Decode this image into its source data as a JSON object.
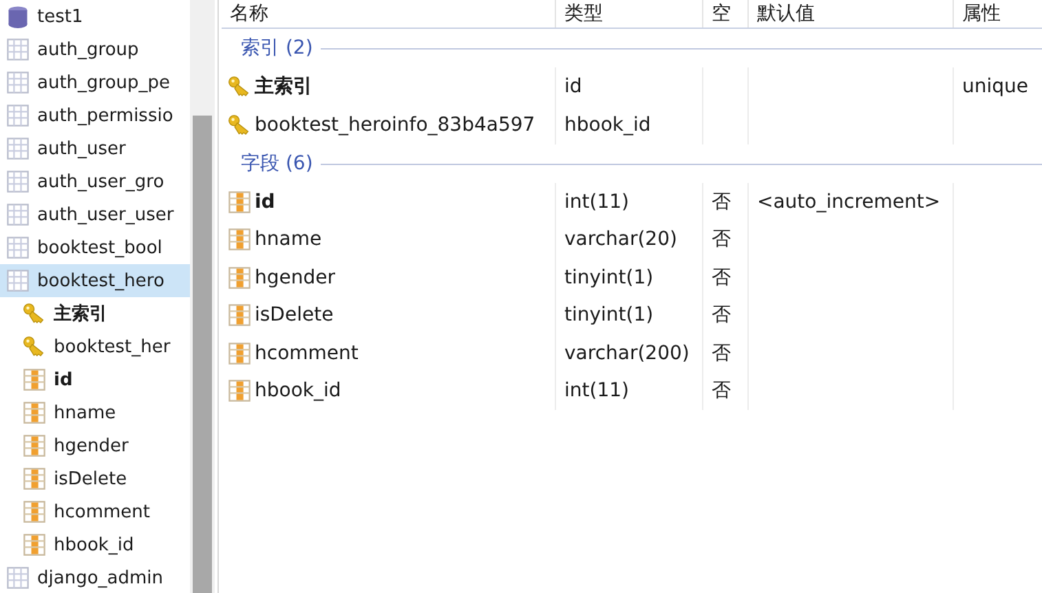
{
  "tree": [
    {
      "kind": "database",
      "label": "test1",
      "children": [
        {
          "kind": "table",
          "label": "auth_group",
          "selected": false
        },
        {
          "kind": "table",
          "label": "auth_group_pe",
          "selected": false
        },
        {
          "kind": "table",
          "label": "auth_permissio",
          "selected": false
        },
        {
          "kind": "table",
          "label": "auth_user",
          "selected": false
        },
        {
          "kind": "table",
          "label": "auth_user_gro",
          "selected": false
        },
        {
          "kind": "table",
          "label": "auth_user_user",
          "selected": false
        },
        {
          "kind": "table",
          "label": "booktest_bool",
          "selected": false
        },
        {
          "kind": "table",
          "label": "booktest_hero",
          "selected": true,
          "children": [
            {
              "kind": "index",
              "label": "主索引",
              "primary": true
            },
            {
              "kind": "index",
              "label": "booktest_her",
              "primary": false
            },
            {
              "kind": "field",
              "label": "id",
              "primary": true
            },
            {
              "kind": "field",
              "label": "hname",
              "primary": false
            },
            {
              "kind": "field",
              "label": "hgender",
              "primary": false
            },
            {
              "kind": "field",
              "label": "isDelete",
              "primary": false
            },
            {
              "kind": "field",
              "label": "hcomment",
              "primary": false
            },
            {
              "kind": "field",
              "label": "hbook_id",
              "primary": false
            }
          ]
        },
        {
          "kind": "table",
          "label": "django_admin",
          "selected": false
        }
      ]
    }
  ],
  "table": {
    "columns": [
      "名称",
      "类型",
      "空",
      "默认值",
      "属性"
    ],
    "sections": [
      {
        "title": "索引 (2)",
        "kind": "index",
        "rows": [
          {
            "name": "主索引",
            "primary": true,
            "type": "id",
            "attr": "unique"
          },
          {
            "name": "booktest_heroinfo_83b4a597",
            "primary": false,
            "type": "hbook_id"
          }
        ]
      },
      {
        "title": "字段 (6)",
        "kind": "field",
        "rows": [
          {
            "name": "id",
            "primary": true,
            "type": "int(11)",
            "null": "否",
            "default": "<auto_increment>"
          },
          {
            "name": "hname",
            "primary": false,
            "type": "varchar(20)",
            "null": "否"
          },
          {
            "name": "hgender",
            "primary": false,
            "type": "tinyint(1)",
            "null": "否"
          },
          {
            "name": "isDelete",
            "primary": false,
            "type": "tinyint(1)",
            "null": "否"
          },
          {
            "name": "hcomment",
            "primary": false,
            "type": "varchar(200)",
            "null": "否"
          },
          {
            "name": "hbook_id",
            "primary": false,
            "type": "int(11)",
            "null": "否"
          }
        ]
      }
    ]
  }
}
